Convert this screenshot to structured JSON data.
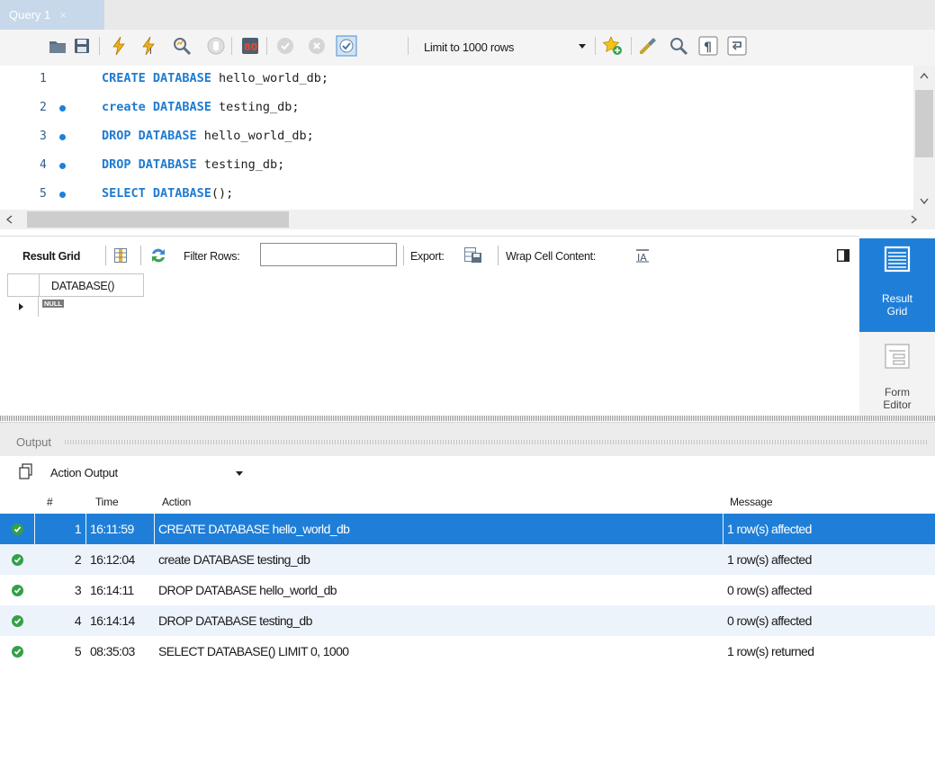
{
  "tab": {
    "title": "Query 1",
    "close": "×"
  },
  "toolbar": {
    "icons": [
      "folder-open-icon",
      "save-icon",
      "execute-icon",
      "execute-current-icon",
      "explain-icon",
      "stop-icon",
      "toggle-continue-icon",
      "commit-icon",
      "rollback-icon",
      "autocommit-icon",
      "bookmark-add-icon",
      "beautify-icon",
      "find-icon",
      "invisible-chars-icon",
      "wrap-icon"
    ],
    "limit_label": "Limit to 1000 rows"
  },
  "editor": {
    "lines": [
      {
        "num": "1",
        "kw": "CREATE DATABASE",
        "rest": " hello_world_db;",
        "dot": false
      },
      {
        "num": "2",
        "kw": "create DATABASE",
        "rest": " testing_db;",
        "dot": true
      },
      {
        "num": "3",
        "kw": "DROP DATABASE",
        "rest": " hello_world_db;",
        "dot": true
      },
      {
        "num": "4",
        "kw": "DROP DATABASE",
        "rest": " testing_db;",
        "dot": true
      },
      {
        "num": "5",
        "kw": "SELECT DATABASE",
        "rest": "();",
        "dot": true
      }
    ]
  },
  "result_toolbar": {
    "result_grid": "Result Grid",
    "filter_rows": "Filter Rows:",
    "filter_value": "",
    "export": "Export:",
    "wrap": "Wrap Cell Content:"
  },
  "grid": {
    "column": "DATABASE()",
    "row_value": "NULL"
  },
  "side_panel": {
    "result_grid_line1": "Result",
    "result_grid_line2": "Grid",
    "form_editor_line1": "Form",
    "form_editor_line2": "Editor"
  },
  "output": {
    "title": "Output",
    "selector": "Action Output",
    "headers": {
      "num": "#",
      "time": "Time",
      "action": "Action",
      "message": "Message"
    },
    "rows": [
      {
        "num": "1",
        "time": "16:11:59",
        "action": "CREATE DATABASE hello_world_db",
        "message": "1 row(s) affected",
        "status": "ok"
      },
      {
        "num": "2",
        "time": "16:12:04",
        "action": "create DATABASE testing_db",
        "message": "1 row(s) affected",
        "status": "ok"
      },
      {
        "num": "3",
        "time": "16:14:11",
        "action": "DROP DATABASE hello_world_db",
        "message": "0 row(s) affected",
        "status": "ok"
      },
      {
        "num": "4",
        "time": "16:14:14",
        "action": "DROP DATABASE testing_db",
        "message": "0 row(s) affected",
        "status": "ok"
      },
      {
        "num": "5",
        "time": "08:35:03",
        "action": "SELECT DATABASE() LIMIT 0, 1000",
        "message": "1 row(s) returned",
        "status": "ok"
      }
    ]
  },
  "colors": {
    "accent": "#1f7fd8",
    "keyword": "#1f7bd0",
    "ok": "#34a047",
    "row_alt": "#ecf3fb"
  }
}
